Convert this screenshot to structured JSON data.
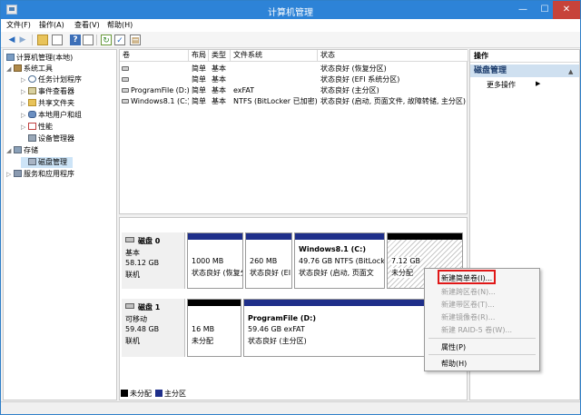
{
  "window": {
    "title": "计算机管理"
  },
  "menu": [
    "文件(F)",
    "操作(A)",
    "查看(V)",
    "帮助(H)"
  ],
  "tree": {
    "root": "计算机管理(本地)",
    "system_tools": "系统工具",
    "task_scheduler": "任务计划程序",
    "event_viewer": "事件查看器",
    "shared_folders": "共享文件夹",
    "local_users": "本地用户和组",
    "performance": "性能",
    "device_manager": "设备管理器",
    "storage": "存储",
    "disk_management": "磁盘管理",
    "services": "服务和应用程序"
  },
  "volumes": {
    "headers": [
      "卷",
      "布局",
      "类型",
      "文件系统",
      "状态"
    ],
    "rows": [
      {
        "name": "",
        "layout": "简单",
        "type": "基本",
        "fs": "",
        "status": "状态良好 (恢复分区)"
      },
      {
        "name": "",
        "layout": "简单",
        "type": "基本",
        "fs": "",
        "status": "状态良好 (EFI 系统分区)"
      },
      {
        "name": "ProgramFile (D:)",
        "layout": "简单",
        "type": "基本",
        "fs": "exFAT",
        "status": "状态良好 (主分区)"
      },
      {
        "name": "Windows8.1 (C:)",
        "layout": "简单",
        "type": "基本",
        "fs": "NTFS (BitLocker 已加密)",
        "status": "状态良好 (启动, 页面文件, 故障转储, 主分区)"
      }
    ]
  },
  "disks": [
    {
      "name": "磁盘 0",
      "kind": "基本",
      "size": "58.12 GB",
      "state": "联机",
      "partitions": [
        {
          "title": "",
          "size": "1000 MB",
          "status": "状态良好 (恢复分",
          "bar": "primary"
        },
        {
          "title": "",
          "size": "260 MB",
          "status": "状态良好 (EI",
          "bar": "primary"
        },
        {
          "title": "Windows8.1  (C:)",
          "size": "49.76 GB NTFS (BitLocke",
          "status": "状态良好 (启动, 页面文",
          "bar": "primary"
        },
        {
          "title": "",
          "size": "7.12 GB",
          "status": "未分配",
          "bar": "unalloc"
        }
      ]
    },
    {
      "name": "磁盘 1",
      "kind": "可移动",
      "size": "59.48 GB",
      "state": "联机",
      "partitions": [
        {
          "title": "",
          "size": "16 MB",
          "status": "未分配",
          "bar": "unalloc"
        },
        {
          "title": "ProgramFile  (D:)",
          "size": "59.46 GB exFAT",
          "status": "状态良好 (主分区)",
          "bar": "primary"
        }
      ]
    }
  ],
  "legend": {
    "unallocated": "未分配",
    "primary": "主分区"
  },
  "actions": {
    "header": "操作",
    "section": "磁盘管理",
    "more": "更多操作"
  },
  "context_menu": {
    "new_simple": "新建简单卷(I)...",
    "new_spanned": "新建跨区卷(N)...",
    "new_striped": "新建带区卷(T)...",
    "new_mirrored": "新建镜像卷(R)...",
    "new_raid5": "新建 RAID-5 卷(W)...",
    "properties": "属性(P)",
    "help": "帮助(H)"
  },
  "colors": {
    "titlebar": "#2d83d7",
    "primary_partition": "#1f2f8a",
    "unallocated": "#000000",
    "highlight": "#e01818"
  }
}
